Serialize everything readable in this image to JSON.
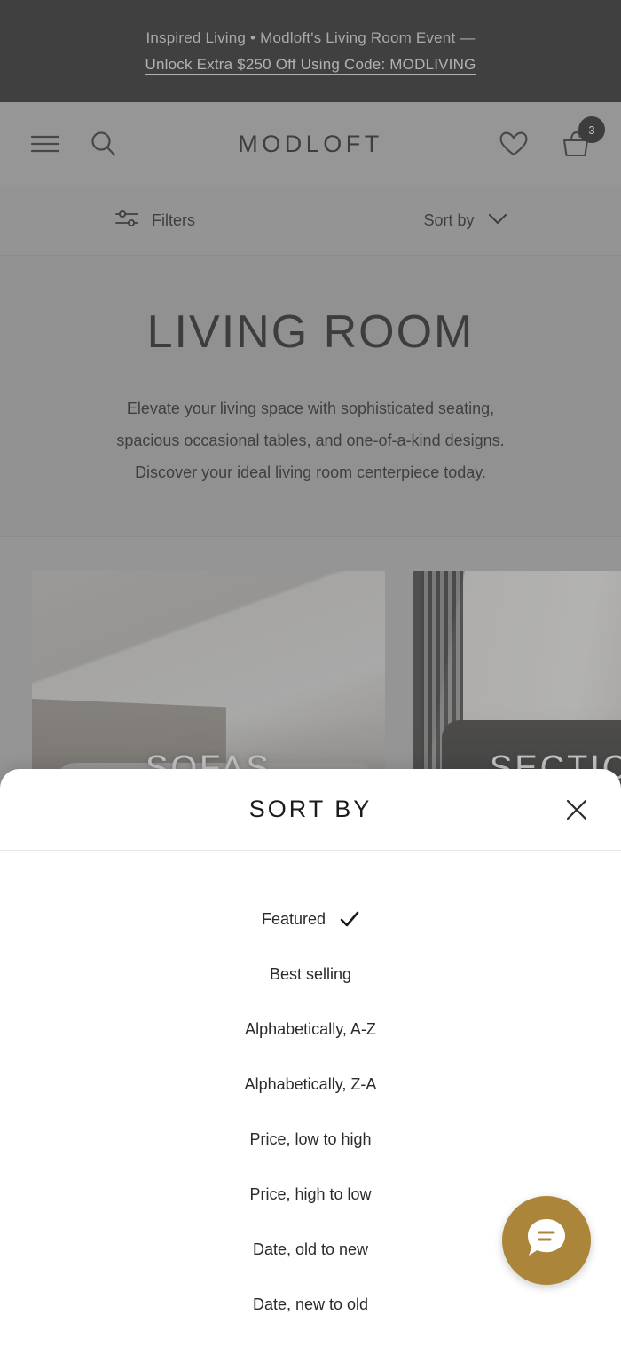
{
  "announcement": {
    "line1": "Inspired Living  •  Modloft's Living Room Event —",
    "line2": "Unlock Extra $250 Off Using Code: MODLIVING"
  },
  "header": {
    "brand": "MODLOFT",
    "menu_icon": "hamburger-icon",
    "search_icon": "search-icon",
    "wishlist_icon": "heart-icon",
    "cart_icon": "shopping-bag-icon",
    "cart_count": "3"
  },
  "filterbar": {
    "filters_label": "Filters",
    "filters_icon": "sliders-icon",
    "sort_label": "Sort by",
    "sort_chevron_icon": "chevron-down-icon"
  },
  "hero": {
    "title": "LIVING ROOM",
    "line1": "Elevate your living space with sophisticated seating,",
    "line2": "spacious occasional tables, and one-of-a-kind designs.",
    "line3": "Discover your ideal living room centerpiece today."
  },
  "tiles": [
    {
      "label": "SOFAS"
    },
    {
      "label": "SECTIONALS"
    }
  ],
  "sort_sheet": {
    "title": "SORT BY",
    "close_icon": "close-icon",
    "check_icon": "check-icon",
    "options": [
      {
        "label": "Featured",
        "selected": true
      },
      {
        "label": "Best selling",
        "selected": false
      },
      {
        "label": "Alphabetically, A-Z",
        "selected": false
      },
      {
        "label": "Alphabetically, Z-A",
        "selected": false
      },
      {
        "label": "Price, low to high",
        "selected": false
      },
      {
        "label": "Price, high to low",
        "selected": false
      },
      {
        "label": "Date, old to new",
        "selected": false
      },
      {
        "label": "Date, new to old",
        "selected": false
      }
    ]
  },
  "chat": {
    "icon": "chat-bubble-icon",
    "accent_color": "#ab8539"
  },
  "colors": {
    "announcement_bg": "#1f1f1f",
    "header_bg": "#b3b3b3",
    "sheet_bg": "#ffffff",
    "text_dark": "#1c1c1c"
  }
}
